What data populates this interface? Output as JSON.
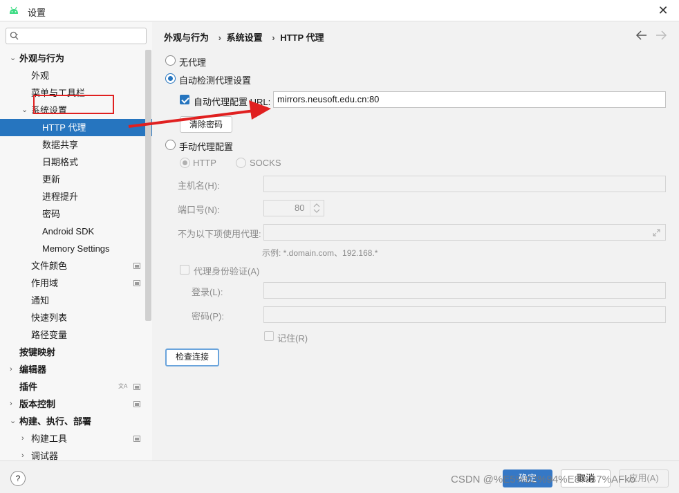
{
  "window": {
    "title": "设置",
    "app_icon": "android-icon",
    "close_icon": "close-icon"
  },
  "sidebar": {
    "search_placeholder": "",
    "items": [
      {
        "label": "外观与行为",
        "indent": 0,
        "expanded": true,
        "bold": true
      },
      {
        "label": "外观",
        "indent": 1
      },
      {
        "label": "菜单与工具栏",
        "indent": 1
      },
      {
        "label": "系统设置",
        "indent": 1,
        "expanded": true
      },
      {
        "label": "HTTP 代理",
        "indent": 2,
        "selected": true
      },
      {
        "label": "数据共享",
        "indent": 2
      },
      {
        "label": "日期格式",
        "indent": 2
      },
      {
        "label": "更新",
        "indent": 2
      },
      {
        "label": "进程提升",
        "indent": 2
      },
      {
        "label": "密码",
        "indent": 2
      },
      {
        "label": "Android SDK",
        "indent": 2
      },
      {
        "label": "Memory Settings",
        "indent": 2
      },
      {
        "label": "文件颜色",
        "indent": 1,
        "badge": true
      },
      {
        "label": "作用域",
        "indent": 1,
        "badge": true
      },
      {
        "label": "通知",
        "indent": 1
      },
      {
        "label": "快速列表",
        "indent": 1
      },
      {
        "label": "路径变量",
        "indent": 1
      },
      {
        "label": "按键映射",
        "indent": 0,
        "bold": true
      },
      {
        "label": "编辑器",
        "indent": 0,
        "bold": true,
        "collapsed": true
      },
      {
        "label": "插件",
        "indent": 0,
        "bold": true,
        "badge": true,
        "translate": true
      },
      {
        "label": "版本控制",
        "indent": 0,
        "bold": true,
        "collapsed": true,
        "badge": true
      },
      {
        "label": "构建、执行、部署",
        "indent": 0,
        "bold": true,
        "expanded": true
      },
      {
        "label": "构建工具",
        "indent": 1,
        "collapsed": true,
        "badge": true
      },
      {
        "label": "调试器",
        "indent": 1,
        "collapsed": true
      }
    ]
  },
  "breadcrumb": [
    "外观与行为",
    "系统设置",
    "HTTP 代理"
  ],
  "breadcrumb_sep": "›",
  "proxy": {
    "no_proxy": "无代理",
    "auto_detect": "自动检测代理设置",
    "auto_config_label": "自动代理配置 URL:",
    "auto_config_value": "mirrors.neusoft.edu.cn:80",
    "clear_password": "清除密码",
    "manual": "手动代理配置",
    "http": "HTTP",
    "socks": "SOCKS",
    "host_label": "主机名(H):",
    "port_label": "端口号(N):",
    "port_value": "80",
    "no_proxy_for_label": "不为以下项使用代理:",
    "example": "示例: *.domain.com、192.168.*",
    "auth_label": "代理身份验证(A)",
    "login_label": "登录(L):",
    "password_label": "密码(P):",
    "remember_label": "记住(R)",
    "check_connection": "检查连接"
  },
  "footer": {
    "help": "?",
    "ok": "确定",
    "cancel": "取消",
    "apply": "应用(A)",
    "watermark": "CSDN @%E5%B2%94%E8%B7%AFko"
  },
  "colors": {
    "accent": "#2675bf",
    "annotation_red": "#e02020"
  }
}
